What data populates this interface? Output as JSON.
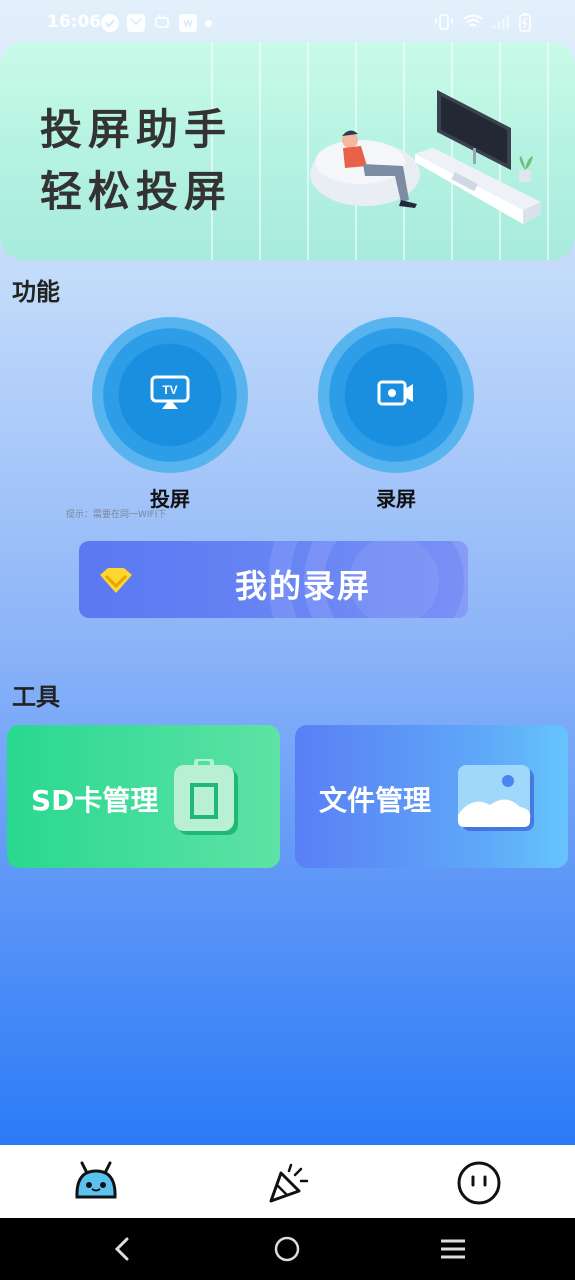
{
  "status_bar": {
    "time": "16:06",
    "left_icons": [
      "check-circle-icon",
      "mail-icon",
      "robot-icon",
      "app-icon",
      "dot-icon"
    ],
    "right_icons": [
      "vibrate-icon",
      "wifi-icon",
      "signal-icon",
      "battery-icon"
    ]
  },
  "banner": {
    "line1": "投屏助手",
    "line2": "轻松投屏"
  },
  "functions": {
    "title": "功能",
    "items": [
      {
        "label": "投屏",
        "icon": "tv-cast-icon"
      },
      {
        "label": "录屏",
        "icon": "video-record-icon"
      }
    ],
    "hint": "提示：需要在同一WIFI下"
  },
  "my_recordings": {
    "label": "我的录屏",
    "icon": "diamond-icon"
  },
  "tools": {
    "title": "工具",
    "items": [
      {
        "label": "SD卡管理",
        "icon": "sd-card-icon"
      },
      {
        "label": "文件管理",
        "icon": "image-folder-icon"
      }
    ]
  },
  "bottom_nav": {
    "items": [
      "robot-face-icon",
      "party-popper-icon",
      "smile-face-icon"
    ]
  },
  "system_nav": [
    "back-icon",
    "home-icon",
    "recent-apps-icon"
  ],
  "colors": {
    "accent_blue": "#1a8fe0",
    "sd_green": "#29d88f",
    "file_blue": "#5a7ff5",
    "my_recordings_bg": "#6a86f4"
  }
}
